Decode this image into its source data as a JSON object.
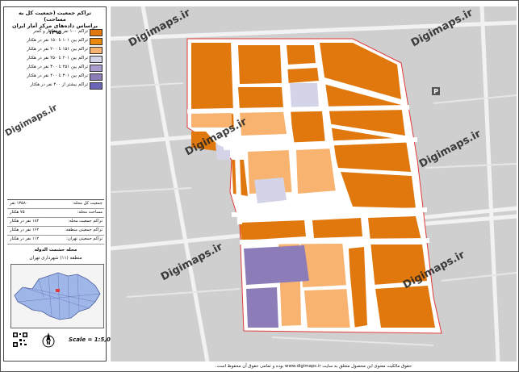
{
  "legend": {
    "title_line1": "تراکم جمعیت (جمعیت کل به مساحت)",
    "title_line2": "براساس داده‌های مرکز آمار ایران ۱۳۹۵",
    "items": [
      {
        "label": "تراکم ۱۰۰ نفر در هکتار و کمتر",
        "color": "#e0780e"
      },
      {
        "label": "تراکم بین ۱۰۱ تا ۱۵۰ نفر در هکتار",
        "color": "#e8880f"
      },
      {
        "label": "تراکم بین ۱۵۱ تا ۲۰۰ نفر در هکتار",
        "color": "#f7b36f"
      },
      {
        "label": "تراکم بین ۲۰۱ تا ۲۵۰ نفر در هکتار",
        "color": "#d4d4e8"
      },
      {
        "label": "تراکم بین ۲۵۱ تا ۳۰۰ نفر در هکتار",
        "color": "#a99bcc"
      },
      {
        "label": "تراکم بین ۳۰۱ تا ۴۰۰ نفر در هکتار",
        "color": "#8c7db8"
      },
      {
        "label": "تراکم بیشتر از ۴۰۰ نفر در هکتار",
        "color": "#6b66b8"
      }
    ]
  },
  "stats": [
    {
      "label": "جمعیت کل محله:",
      "value": "۱۳۵۸۰ نفر"
    },
    {
      "label": "مساحت محله:",
      "value": "۷۵ هکتار"
    },
    {
      "label": "تراکم جمعیت محله:",
      "value": "۱۸۲ نفر در هکتار"
    },
    {
      "label": "تراکم جمعیتی منطقه:",
      "value": "۱۶۲ نفر در هکتار"
    },
    {
      "label": "تراکم جمعیتی تهران:",
      "value": "۱۱۲ نفر در هکتار"
    }
  ],
  "location": {
    "neighborhood": "محله حشمت الدوله",
    "district": "منطقه (۱۱) شهرداری تهران"
  },
  "scale": "Scale = 1:5,000",
  "north_letter": "N",
  "watermark": "Digimaps.ir",
  "footer": "حقوق مالکیت معنوی این محصول متعلق به سایت www.digimaps.ir بوده و تمامی حقوق آن محفوظ است.",
  "parking_letter": "P",
  "colors": {
    "orange": "#e0780e",
    "light_orange": "#f7b36f",
    "lavender": "#d4d4e8",
    "purple": "#8c7db8",
    "boundary": "#e23b3b",
    "road": "#ffffff",
    "background": "#cfcfcf"
  }
}
